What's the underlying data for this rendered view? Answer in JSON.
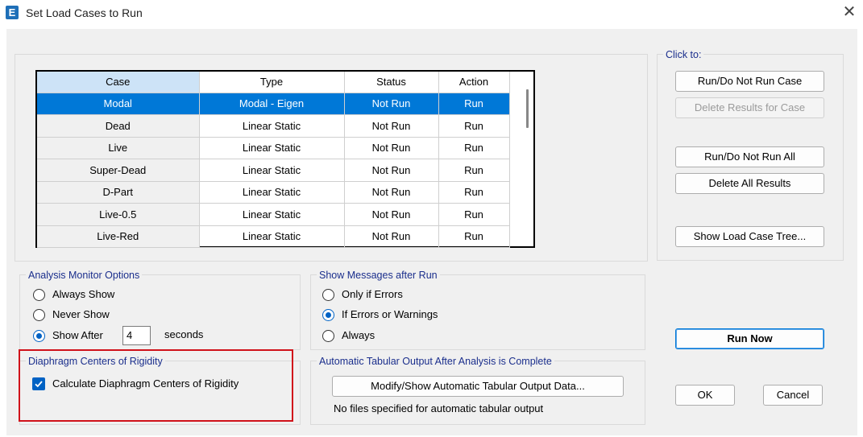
{
  "window": {
    "title": "Set Load Cases to Run",
    "app_icon_letter": "E"
  },
  "grid": {
    "columns": [
      "Case",
      "Type",
      "Status",
      "Action"
    ],
    "rows": [
      {
        "case": "Modal",
        "type": "Modal - Eigen",
        "status": "Not Run",
        "action": "Run",
        "selected": true
      },
      {
        "case": "Dead",
        "type": "Linear Static",
        "status": "Not Run",
        "action": "Run"
      },
      {
        "case": "Live",
        "type": "Linear Static",
        "status": "Not Run",
        "action": "Run"
      },
      {
        "case": "Super-Dead",
        "type": "Linear Static",
        "status": "Not Run",
        "action": "Run"
      },
      {
        "case": "D-Part",
        "type": "Linear Static",
        "status": "Not Run",
        "action": "Run"
      },
      {
        "case": "Live-0.5",
        "type": "Linear Static",
        "status": "Not Run",
        "action": "Run"
      },
      {
        "case": "Live-Red",
        "type": "Linear Static",
        "status": "Not Run",
        "action": "Run"
      }
    ]
  },
  "click_to": {
    "title": "Click to:",
    "run_do_not_run_case": "Run/Do Not Run Case",
    "delete_results_for_case": "Delete Results for Case",
    "run_do_not_run_all": "Run/Do Not Run All",
    "delete_all_results": "Delete All Results",
    "show_load_case_tree": "Show Load Case Tree..."
  },
  "analysis_monitor": {
    "title": "Analysis Monitor Options",
    "always_show": "Always Show",
    "never_show": "Never Show",
    "show_after": "Show After",
    "seconds_value": "4",
    "seconds_label": "seconds",
    "selected": "show_after"
  },
  "show_messages": {
    "title": "Show Messages after Run",
    "only_if_errors": "Only if Errors",
    "if_errors_or_warnings": "If Errors or Warnings",
    "always": "Always",
    "selected": "if_errors_or_warnings"
  },
  "diaphragm": {
    "title": "Diaphragm Centers of Rigidity",
    "checkbox_label": "Calculate Diaphragm Centers of Rigidity",
    "checked": true
  },
  "tabular_output": {
    "title": "Automatic Tabular Output After Analysis is Complete",
    "button": "Modify/Show Automatic Tabular Output Data...",
    "status": "No files specified for automatic tabular output"
  },
  "actions": {
    "run_now": "Run Now",
    "ok": "OK",
    "cancel": "Cancel"
  },
  "colors": {
    "selection": "#0078d7",
    "group_title": "#1a2e8c",
    "highlight_box": "#d0111a"
  }
}
